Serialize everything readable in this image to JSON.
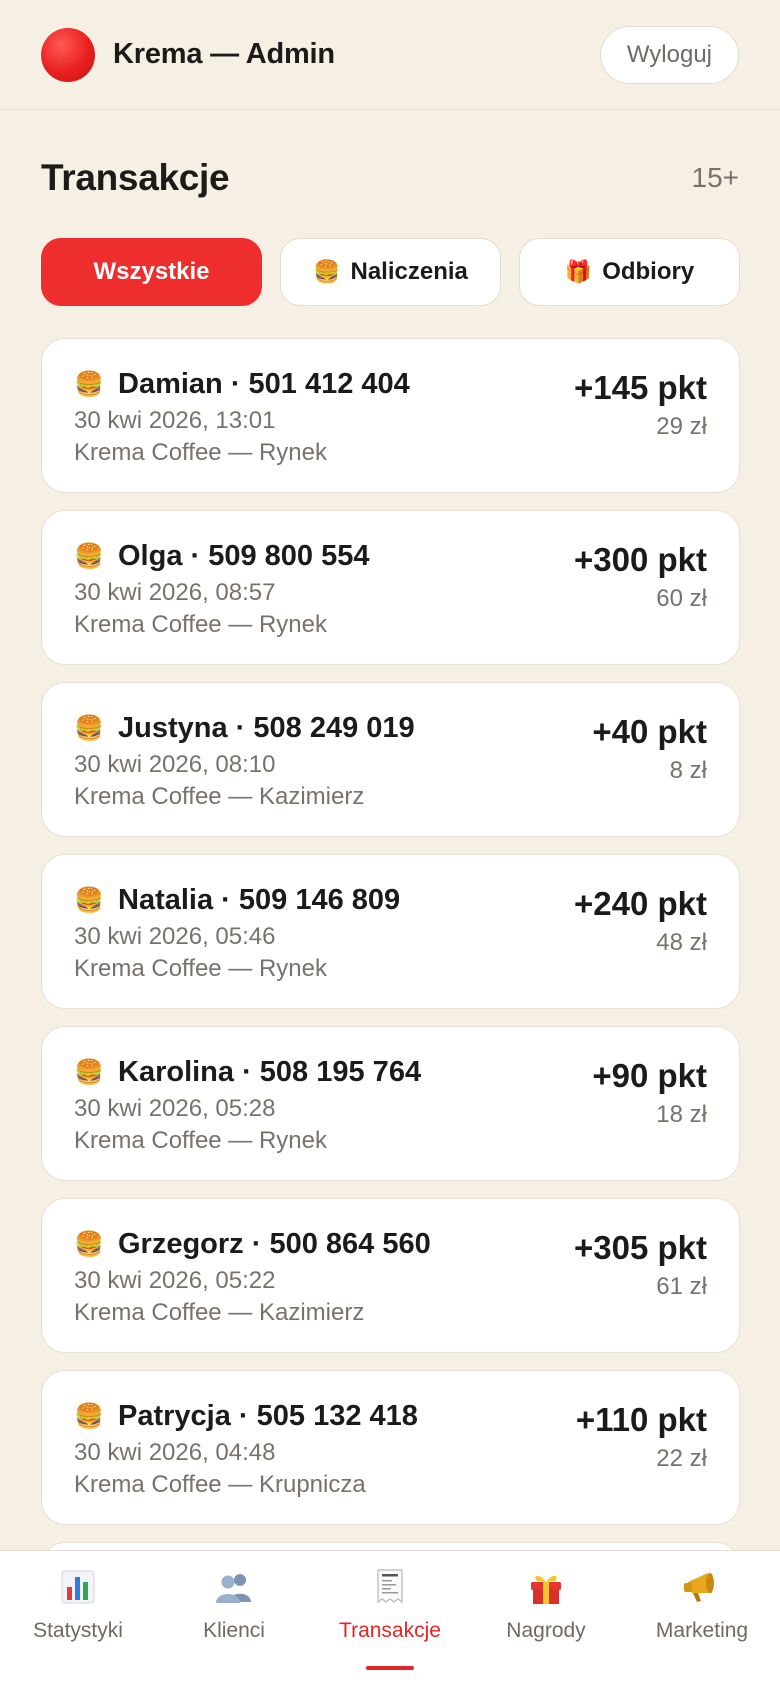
{
  "header": {
    "title": "Krema — Admin",
    "logout_label": "Wyloguj",
    "logo_color": "#e81f1f"
  },
  "section": {
    "title": "Transakcje",
    "count": "15+"
  },
  "filters": [
    {
      "label": "Wszystkie",
      "icon": "",
      "active": true
    },
    {
      "label": "Naliczenia",
      "icon": "🍔",
      "active": false
    },
    {
      "label": "Odbiory",
      "icon": "🎁",
      "active": false
    }
  ],
  "transactions": [
    {
      "icon": "🍔",
      "name_phone": "Damian · 501 412 404",
      "date": "30 kwi 2026, 13:01",
      "location": "Krema Coffee — Rynek",
      "points": "+145 pkt",
      "amount": "29 zł"
    },
    {
      "icon": "🍔",
      "name_phone": "Olga · 509 800 554",
      "date": "30 kwi 2026, 08:57",
      "location": "Krema Coffee — Rynek",
      "points": "+300 pkt",
      "amount": "60 zł"
    },
    {
      "icon": "🍔",
      "name_phone": "Justyna · 508 249 019",
      "date": "30 kwi 2026, 08:10",
      "location": "Krema Coffee — Kazimierz",
      "points": "+40 pkt",
      "amount": "8 zł"
    },
    {
      "icon": "🍔",
      "name_phone": "Natalia · 509 146 809",
      "date": "30 kwi 2026, 05:46",
      "location": "Krema Coffee — Rynek",
      "points": "+240 pkt",
      "amount": "48 zł"
    },
    {
      "icon": "🍔",
      "name_phone": "Karolina · 508 195 764",
      "date": "30 kwi 2026, 05:28",
      "location": "Krema Coffee — Rynek",
      "points": "+90 pkt",
      "amount": "18 zł"
    },
    {
      "icon": "🍔",
      "name_phone": "Grzegorz · 500 864 560",
      "date": "30 kwi 2026, 05:22",
      "location": "Krema Coffee — Kazimierz",
      "points": "+305 pkt",
      "amount": "61 zł"
    },
    {
      "icon": "🍔",
      "name_phone": "Patrycja · 505 132 418",
      "date": "30 kwi 2026, 04:48",
      "location": "Krema Coffee — Krupnicza",
      "points": "+110 pkt",
      "amount": "22 zł"
    }
  ],
  "bottom_nav": [
    {
      "label": "Statystyki",
      "icon": "bar-chart-icon",
      "active": false
    },
    {
      "label": "Klienci",
      "icon": "users-icon",
      "active": false
    },
    {
      "label": "Transakcje",
      "icon": "receipt-icon",
      "active": true
    },
    {
      "label": "Nagrody",
      "icon": "gift-icon",
      "active": false
    },
    {
      "label": "Marketing",
      "icon": "megaphone-icon",
      "active": false
    }
  ],
  "accent_color": "#ee2d2d"
}
